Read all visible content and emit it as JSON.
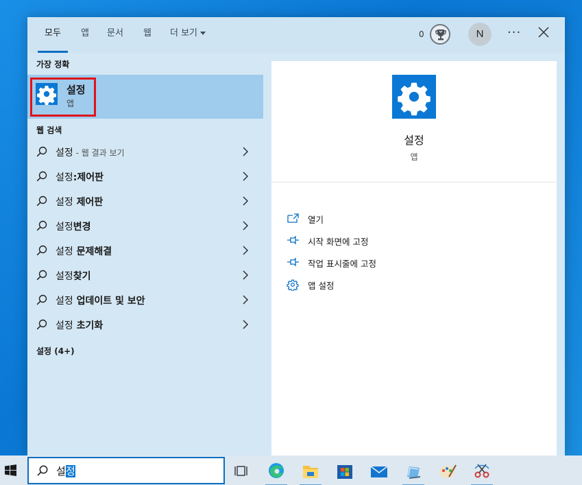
{
  "tabs": [
    {
      "label": "모두",
      "active": true
    },
    {
      "label": "앱"
    },
    {
      "label": "문서"
    },
    {
      "label": "웹"
    },
    {
      "label": "더 보기"
    }
  ],
  "header": {
    "points": "0",
    "avatar_initial": "N",
    "more_options": "···"
  },
  "left": {
    "best_match_header": "가장 정확",
    "best_match": {
      "title": "설정",
      "subtitle": "앱",
      "icon": "gear-icon"
    },
    "web_header": "웹 검색",
    "web_results": [
      {
        "prefix": "설정",
        "suffix": "",
        "note": " - 웹 결과 보기"
      },
      {
        "prefix": "설정",
        "suffix": ":제어판",
        "note": ""
      },
      {
        "prefix": "설정",
        "suffix": " 제어판",
        "note": ""
      },
      {
        "prefix": "설정",
        "suffix": "변경",
        "note": ""
      },
      {
        "prefix": "설정",
        "suffix": " 문제해결",
        "note": ""
      },
      {
        "prefix": "설정",
        "suffix": "찾기",
        "note": ""
      },
      {
        "prefix": "설정",
        "suffix": " 업데이트 및 보안",
        "note": ""
      },
      {
        "prefix": "설정",
        "suffix": " 초기화",
        "note": ""
      }
    ],
    "more_header": "설정 (4+)"
  },
  "detail": {
    "title": "설정",
    "subtitle": "앱",
    "actions": [
      {
        "label": "열기",
        "icon": "open-icon"
      },
      {
        "label": "시작 화면에 고정",
        "icon": "pin-icon"
      },
      {
        "label": "작업 표시줄에 고정",
        "icon": "pin-icon"
      },
      {
        "label": "앱 설정",
        "icon": "gear-icon"
      }
    ]
  },
  "taskbar": {
    "search_typed": "설",
    "search_selected": "정",
    "apps": [
      "task-view-icon",
      "edge-icon",
      "file-explorer-icon",
      "store-icon",
      "mail-icon",
      "notepad-icon",
      "paint-icon",
      "snipping-tool-icon"
    ]
  },
  "colors": {
    "accent": "#0a78d4",
    "highlight": "#e0131a",
    "selected_row": "#9fcbec"
  }
}
